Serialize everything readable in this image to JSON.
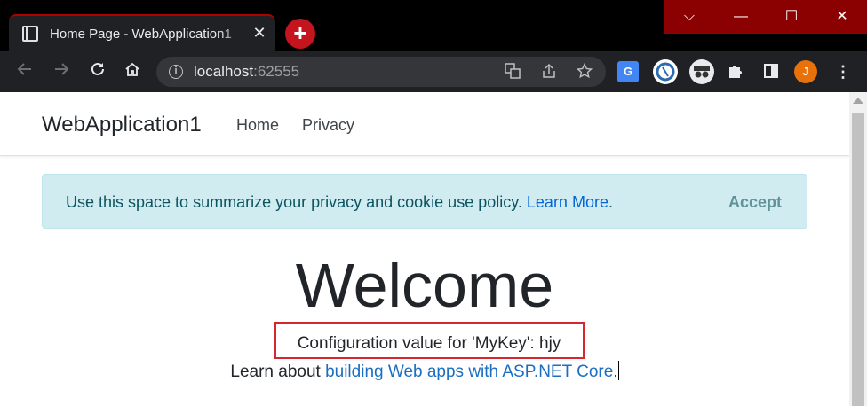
{
  "browser": {
    "tab_title": "Home Page - WebApplication1",
    "tab_close": "✕",
    "new_tab_label": "+",
    "window_controls": {
      "dropdown": "⌵",
      "minimize": "—",
      "maximize": "☐",
      "close": "✕"
    },
    "url_host": "localhost",
    "url_port": ":62555",
    "profile_initial": "J",
    "icons": [
      "back-icon",
      "forward-icon",
      "reload-icon",
      "home-icon",
      "info-icon",
      "translate-icon",
      "share-icon",
      "star-icon",
      "google-translate-icon",
      "extension-icon",
      "incognito-icon",
      "puzzle-icon",
      "sidepanel-icon",
      "profile-icon",
      "more-icon"
    ]
  },
  "site": {
    "brand": "WebApplication1",
    "nav": [
      {
        "label": "Home"
      },
      {
        "label": "Privacy"
      }
    ],
    "cookie": {
      "message": "Use this space to summarize your privacy and cookie use policy.",
      "link": "Learn More",
      "suffix": ".",
      "accept": "Accept"
    },
    "welcome": "Welcome",
    "config_text": "Configuration value for 'MyKey': hjy",
    "learn_prefix": "Learn about ",
    "learn_link": "building Web apps with ASP.NET Core",
    "learn_suffix": "."
  },
  "colors": {
    "highlight_box": "#d6262f",
    "link": "#1b6ec2",
    "alert_bg": "#d1ecf1",
    "window_controls_bg": "#8b0000"
  }
}
